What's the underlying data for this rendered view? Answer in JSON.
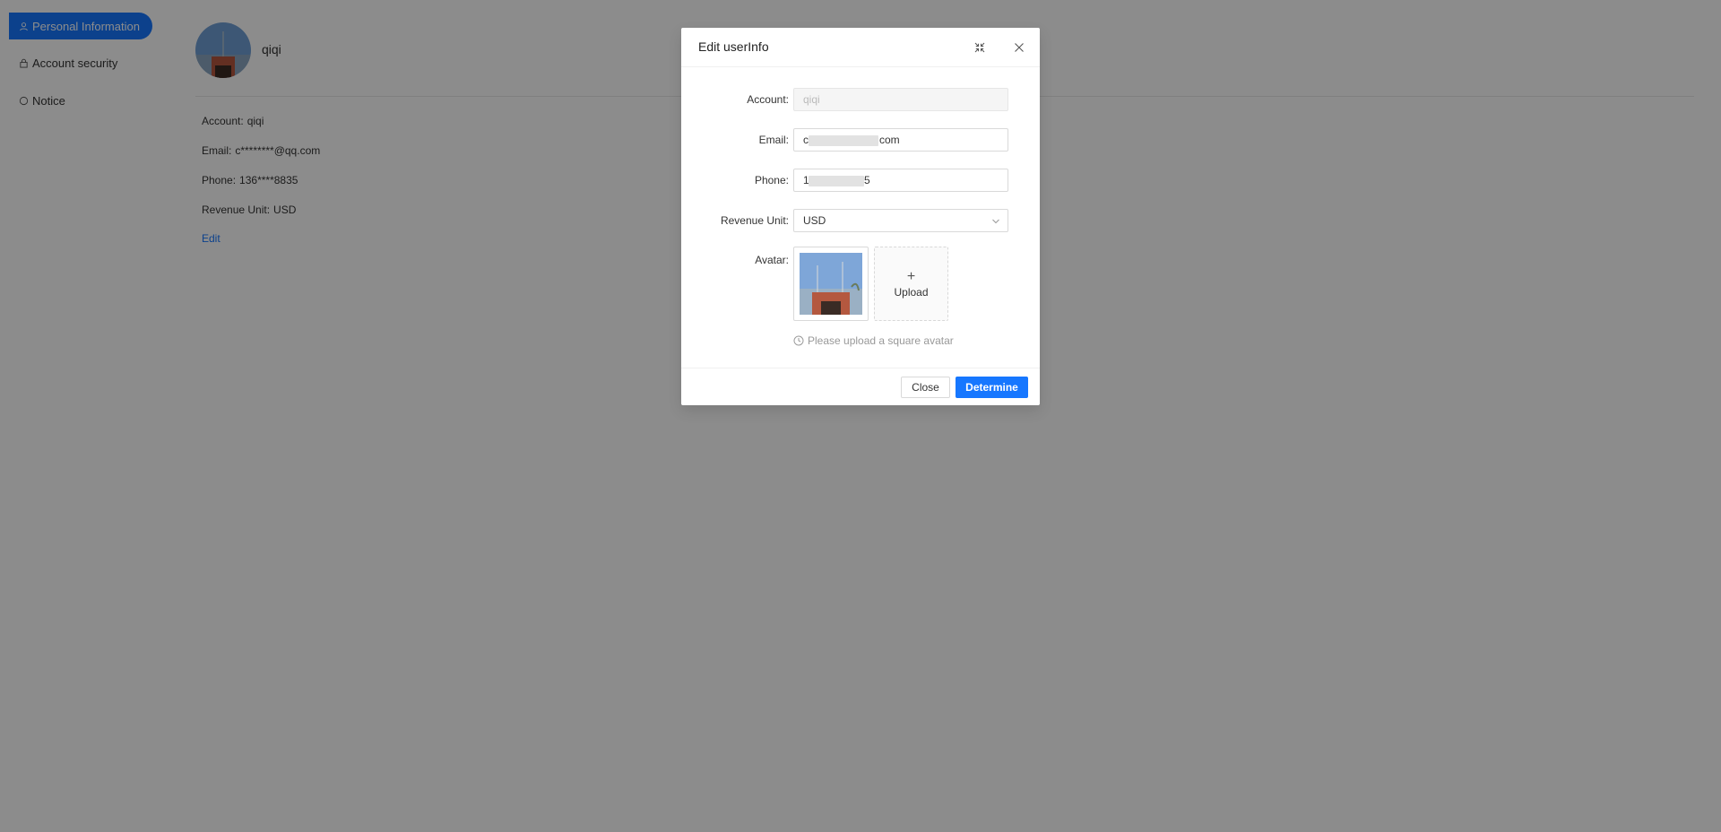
{
  "sidebar": {
    "items": [
      {
        "label": "Personal Information",
        "icon": "user-icon",
        "active": true
      },
      {
        "label": "Account security",
        "icon": "lock-icon",
        "active": false
      },
      {
        "label": "Notice",
        "icon": "chat-bubble-icon",
        "active": false
      }
    ]
  },
  "profile": {
    "name": "qiqi",
    "account_label": "Account:",
    "account_value": "qiqi",
    "email_label": "Email:",
    "email_value": "c********@qq.com",
    "phone_label": "Phone:",
    "phone_value": "136****8835",
    "revenue_label": "Revenue Unit:",
    "revenue_value": "USD",
    "edit_label": "Edit"
  },
  "modal": {
    "title": "Edit userInfo",
    "fields": {
      "account": {
        "label": "Account:",
        "value": "qiqi"
      },
      "email": {
        "label": "Email:",
        "value_start": "c",
        "value_end": "com"
      },
      "phone": {
        "label": "Phone:",
        "value_start": "1",
        "value_end": "5"
      },
      "revenue_unit": {
        "label": "Revenue Unit:",
        "value": "USD"
      },
      "avatar": {
        "label": "Avatar:",
        "upload_label": "Upload"
      }
    },
    "hint": "Please upload a square avatar",
    "close_label": "Close",
    "ok_label": "Determine"
  },
  "colors": {
    "primary": "#1677ff",
    "mask": "rgba(0,0,0,0.45)"
  }
}
